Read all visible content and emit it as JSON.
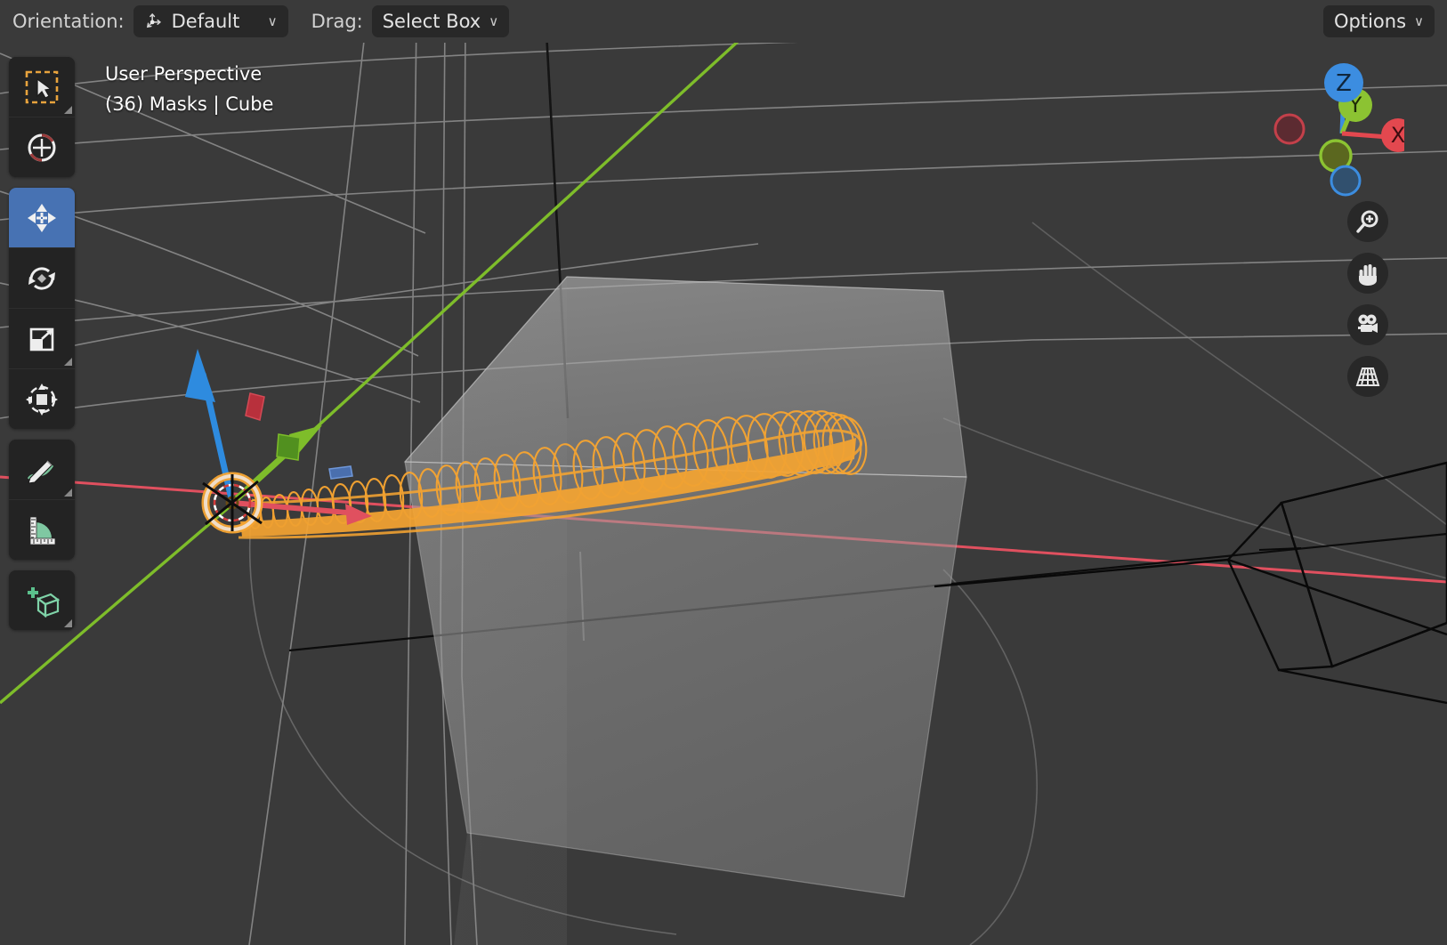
{
  "header": {
    "orientation_label": "Orientation:",
    "orientation_value": "Default",
    "orientation_icon": "transform-orientation-icon",
    "drag_label": "Drag:",
    "drag_value": "Select Box",
    "options_label": "Options",
    "chevron": "∨"
  },
  "viewport": {
    "perspective_text": "User Perspective",
    "object_text": "(36) Masks | Cube",
    "background_color": "#3a3a3a",
    "grid_color": "#b4b4b4",
    "x_axis_color": "#e05a6b",
    "y_axis_color": "#7ebd2a",
    "z_axis_color": "#111111",
    "selected_color": "#f5a431",
    "cube_fill": "#a8a8a8",
    "wire_color": "#000000"
  },
  "toolbar": {
    "items": [
      {
        "name": "select-box-tool",
        "label": "Select Box",
        "active": false,
        "has_corner": true
      },
      {
        "name": "cursor-tool",
        "label": "Cursor",
        "active": false,
        "has_corner": false
      },
      {
        "name": "move-tool",
        "label": "Move",
        "active": true,
        "has_corner": false
      },
      {
        "name": "rotate-tool",
        "label": "Rotate",
        "active": false,
        "has_corner": false
      },
      {
        "name": "scale-tool",
        "label": "Scale",
        "active": false,
        "has_corner": true
      },
      {
        "name": "transform-tool",
        "label": "Transform",
        "active": false,
        "has_corner": false
      },
      {
        "name": "annotate-tool",
        "label": "Annotate",
        "active": false,
        "has_corner": true
      },
      {
        "name": "measure-tool",
        "label": "Measure",
        "active": false,
        "has_corner": false
      },
      {
        "name": "add-cube-tool",
        "label": "Add Cube",
        "active": false,
        "has_corner": true
      }
    ]
  },
  "nav_gizmo": {
    "axes": [
      {
        "label": "Z",
        "color": "#3c8de0",
        "filled": true
      },
      {
        "label": "Y",
        "color": "#8cc332",
        "filled": true
      },
      {
        "label": "X",
        "color": "#e3484f",
        "filled": true
      },
      {
        "label": "",
        "color": "#a03b44",
        "filled": false
      },
      {
        "label": "",
        "color": "#6f8f1e",
        "filled": false
      },
      {
        "label": "",
        "color": "#2f5f91",
        "filled": false
      }
    ]
  },
  "nav_buttons": [
    {
      "name": "zoom-button",
      "label": "Zoom",
      "icon": "magnifier-plus-icon"
    },
    {
      "name": "pan-button",
      "label": "Move View",
      "icon": "hand-icon"
    },
    {
      "name": "camera-view-button",
      "label": "Camera View",
      "icon": "camera-icon"
    },
    {
      "name": "perspective-toggle-button",
      "label": "Toggle Perspective/Orthographic",
      "icon": "grid-perspective-icon"
    }
  ]
}
